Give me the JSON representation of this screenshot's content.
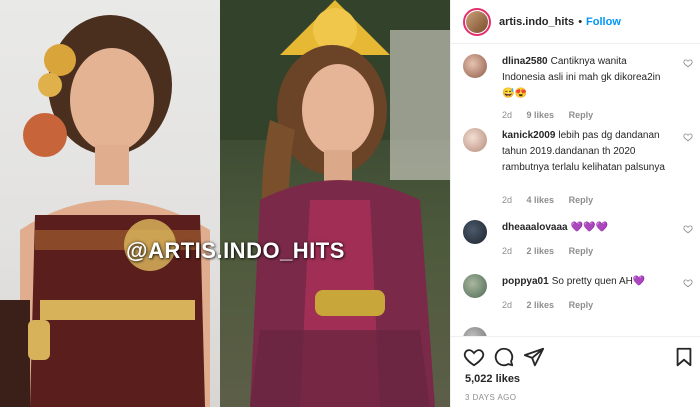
{
  "post": {
    "watermark": "@ARTIS.INDO_HITS"
  },
  "header": {
    "username": "artis.indo_hits",
    "separator": "•",
    "follow_label": "Follow"
  },
  "comments": [
    {
      "username": "dlina2580",
      "text": "Cantiknya wanita Indonesia asli ini mah gk dikorea2in 😅😍",
      "age": "2d",
      "likes": "9 likes",
      "reply": "Reply"
    },
    {
      "username": "kanick2009",
      "text": "lebih pas dg dandanan tahun 2019.dandanan th 2020 rambutnya terlalu kelihatan palsunya",
      "age": "2d",
      "likes": "4 likes",
      "reply": "Reply"
    },
    {
      "username": "dheaaalovaaa",
      "text": "💜💜💜",
      "age": "2d",
      "likes": "2 likes",
      "reply": "Reply"
    },
    {
      "username": "poppya01",
      "text": "So pretty quen AH💜",
      "age": "2d",
      "likes": "2 likes",
      "reply": "Reply"
    }
  ],
  "footer": {
    "likes": "5,022 likes",
    "date": "3 DAYS AGO"
  },
  "colors": {
    "accent": "#0095f6",
    "text": "#262626",
    "muted": "#8e8e8e",
    "border": "#efefef"
  }
}
